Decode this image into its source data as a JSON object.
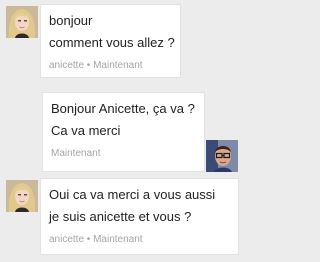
{
  "messages": [
    {
      "lines": [
        "bonjour",
        "comment vous allez ?"
      ],
      "meta": "anicette • Maintenant",
      "avatar": "blonde-woman-avatar",
      "side": "left"
    },
    {
      "lines": [
        "Bonjour Anicette, ça va ?",
        "Ca va merci"
      ],
      "meta": "Maintenant",
      "avatar": "man-with-glasses-avatar",
      "side": "right"
    },
    {
      "lines": [
        "Oui ca va merci a vous aussi",
        "je suis anicette et vous ?"
      ],
      "meta": "anicette • Maintenant",
      "avatar": "blonde-woman-avatar",
      "side": "left"
    }
  ],
  "colors": {
    "background": "#ececec",
    "bubble": "#ffffff",
    "text": "#222222",
    "meta": "#a5a5a5"
  }
}
